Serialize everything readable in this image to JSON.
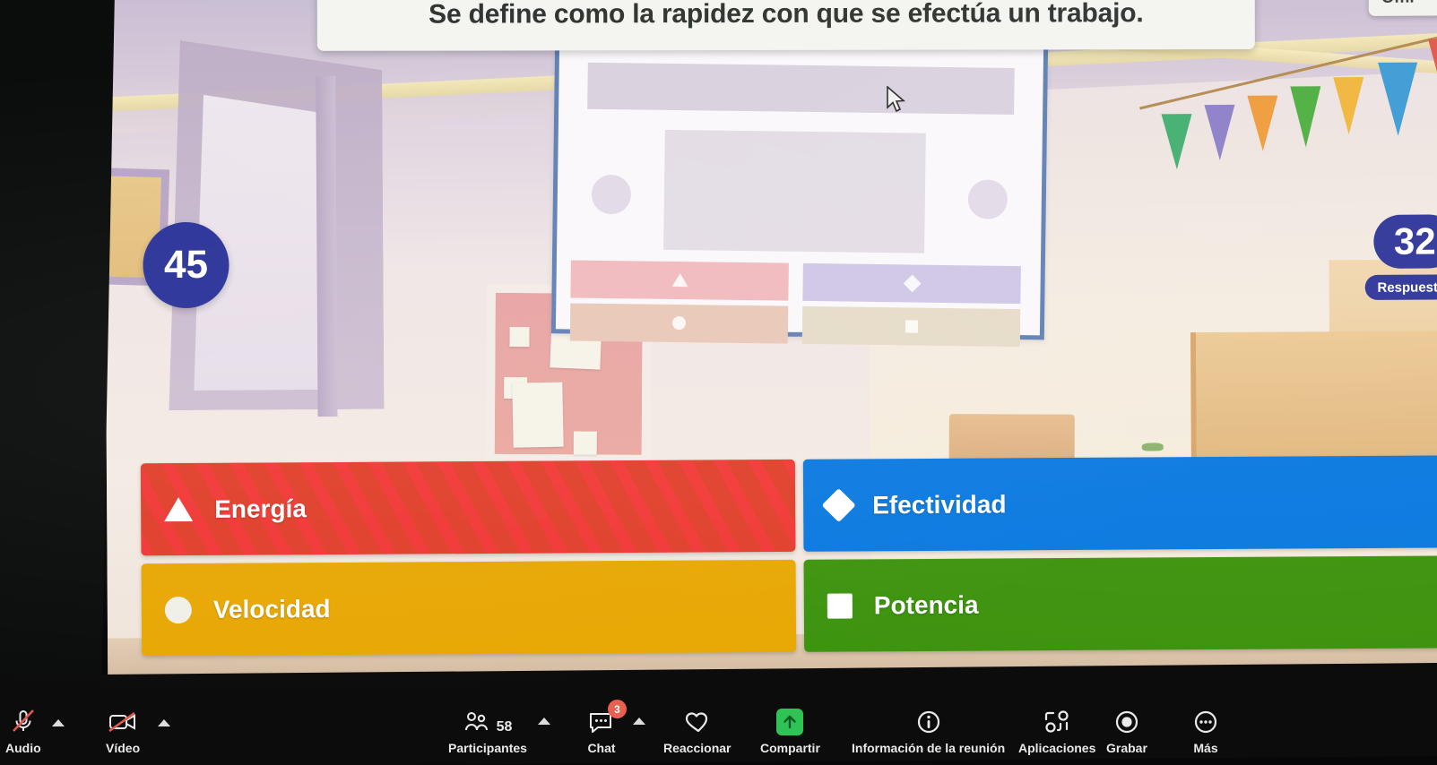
{
  "meta": {
    "app": "Zoom",
    "content": "Kahoot quiz question"
  },
  "quiz": {
    "question": "Se define como la rapidez con que se efectúa un trabajo.",
    "timer": "45",
    "answers_count": "32",
    "answers_label": "Respuestas",
    "skip_label": "Omi",
    "accent_color": "#2b3499",
    "options": [
      {
        "label": "Energía",
        "shape": "triangle",
        "color": "#e0402c"
      },
      {
        "label": "Efectividad",
        "shape": "diamond",
        "color": "#0a79e0"
      },
      {
        "label": "Velocidad",
        "shape": "circle",
        "color": "#e8a805"
      },
      {
        "label": "Potencia",
        "shape": "square",
        "color": "#3d940f"
      }
    ]
  },
  "toolbar": {
    "audio": {
      "label": "Audio",
      "state": "muted"
    },
    "video": {
      "label": "Vídeo",
      "state": "stopped"
    },
    "participants": {
      "label": "Participantes",
      "count": "58"
    },
    "chat": {
      "label": "Chat",
      "badge": "3"
    },
    "react": {
      "label": "Reaccionar"
    },
    "share": {
      "label": "Compartir",
      "color": "#2fc255"
    },
    "info": {
      "label": "Información de la reunión"
    },
    "apps": {
      "label": "Aplicaciones"
    },
    "record": {
      "label": "Grabar"
    },
    "more": {
      "label": "Más"
    }
  },
  "bunting": [
    {
      "color": "#3fae6e"
    },
    {
      "color": "#8b7ec8"
    },
    {
      "color": "#ef9a3a"
    },
    {
      "color": "#4cae3f"
    },
    {
      "color": "#f0b63d"
    },
    {
      "color": "#3b9bd4"
    },
    {
      "color": "#e0564c"
    }
  ]
}
